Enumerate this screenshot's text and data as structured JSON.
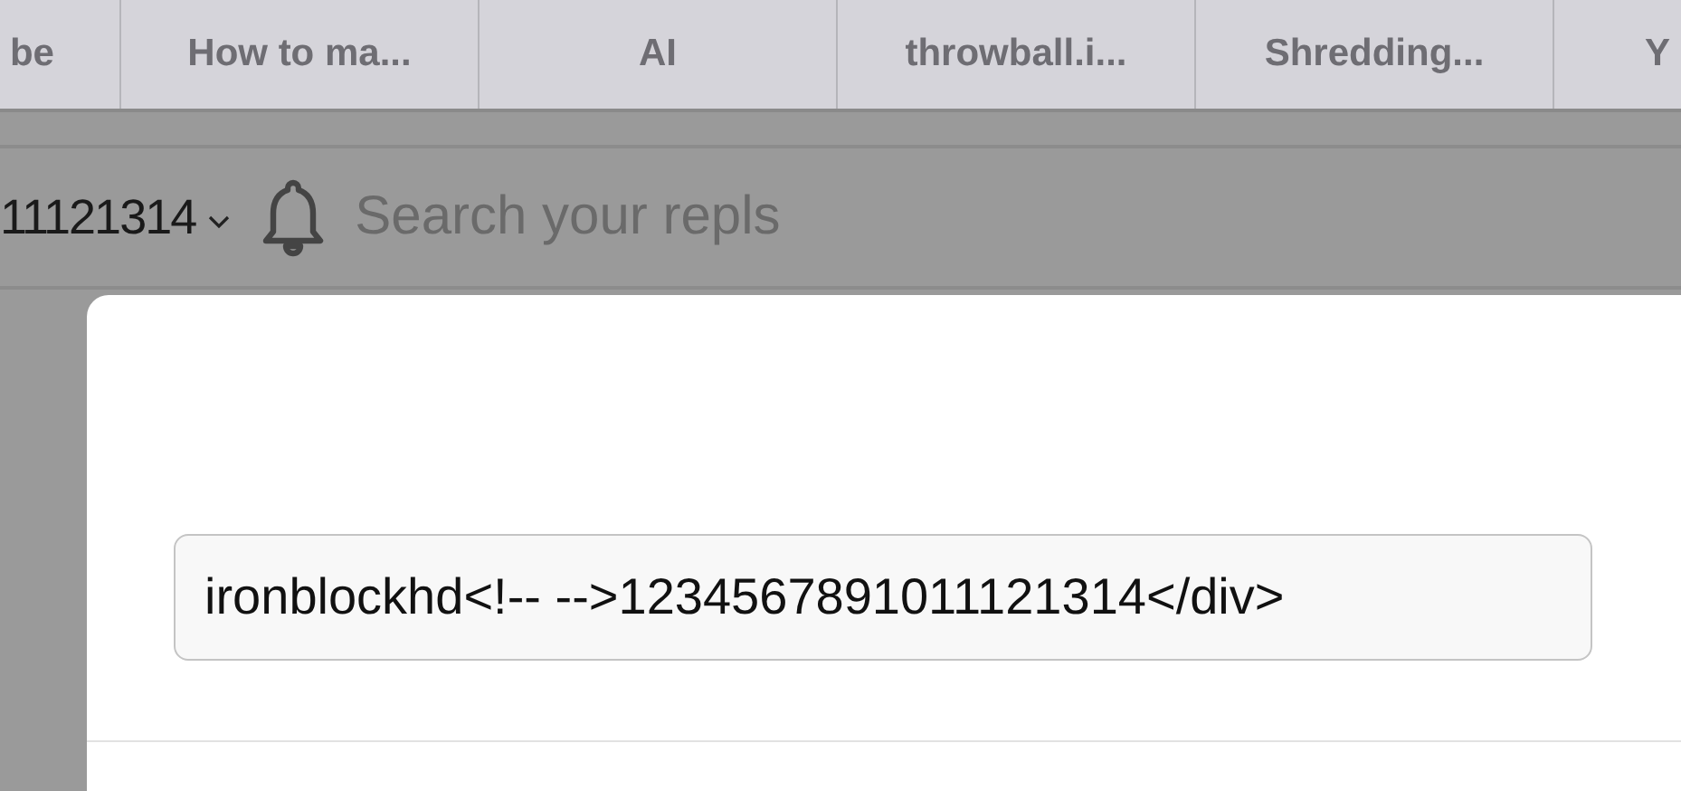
{
  "tabs": [
    {
      "label": "be",
      "selected": false
    },
    {
      "label": "How to ma...",
      "selected": false
    },
    {
      "label": "AI",
      "selected": false
    },
    {
      "label": "throwball.i...",
      "selected": false
    },
    {
      "label": "Shredding...",
      "selected": false
    },
    {
      "label": "Y",
      "selected": false
    }
  ],
  "header": {
    "account": "11121314",
    "search": {
      "placeholder": "Search your repls"
    }
  },
  "dialog": {
    "input": {
      "value": "ironblockhd<!-- -->1234567891011121314</div>"
    }
  }
}
